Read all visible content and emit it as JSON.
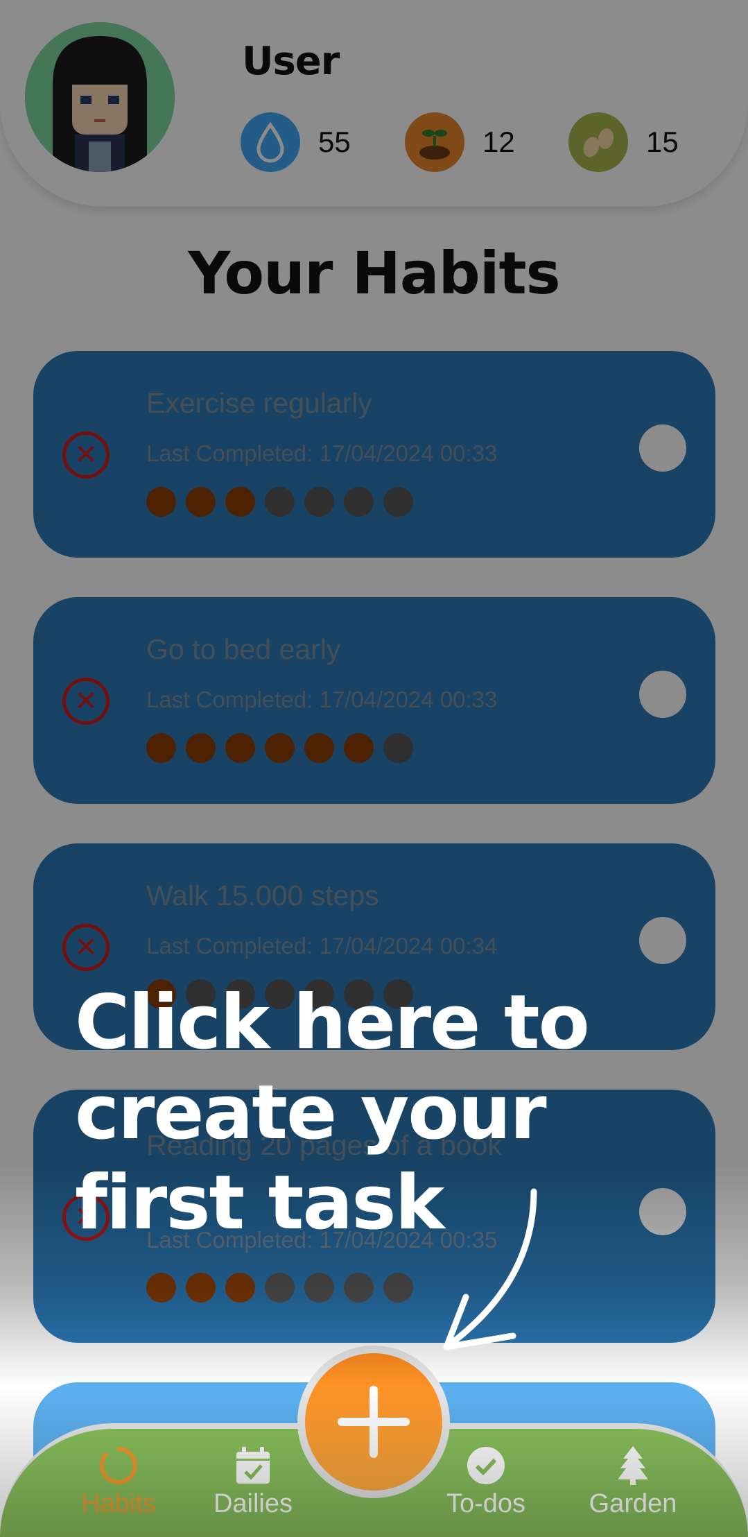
{
  "header": {
    "username": "User",
    "stats": [
      {
        "icon": "water-drop-icon",
        "value": "55",
        "color": "#3fa9f5"
      },
      {
        "icon": "sprout-soil-icon",
        "value": "12",
        "color": "#e8852b"
      },
      {
        "icon": "seeds-icon",
        "value": "15",
        "color": "#a8b64a"
      }
    ]
  },
  "main": {
    "title": "Your Habits",
    "habits": [
      {
        "name": "Exercise regularly",
        "last_completed": "Last Completed: 17/04/2024 00:33",
        "progress": 3,
        "total": 7
      },
      {
        "name": "Go to bed early",
        "last_completed": "Last Completed: 17/04/2024 00:33",
        "progress": 6,
        "total": 7
      },
      {
        "name": "Walk 15.000 steps",
        "last_completed": "Last Completed: 17/04/2024 00:34",
        "progress": 1,
        "total": 7
      },
      {
        "name": "Reading 20 pages of a book",
        "last_completed": "Last Completed: 17/04/2024 00:35",
        "progress": 3,
        "total": 7
      }
    ]
  },
  "onboarding": {
    "hint": "Click here to create your first task"
  },
  "nav": {
    "items": [
      {
        "label": "Habits",
        "icon": "spinner-ring-icon",
        "active": true
      },
      {
        "label": "Dailies",
        "icon": "calendar-check-icon",
        "active": false
      },
      {
        "label": "To-dos",
        "icon": "check-circle-icon",
        "active": false
      },
      {
        "label": "Garden",
        "icon": "pine-tree-icon",
        "active": false
      }
    ],
    "fab_icon": "plus-icon"
  },
  "colors": {
    "card": "#2b7ab7",
    "accent": "#f29a2e",
    "nav": "#89c05c",
    "delete": "#d21c1c"
  }
}
